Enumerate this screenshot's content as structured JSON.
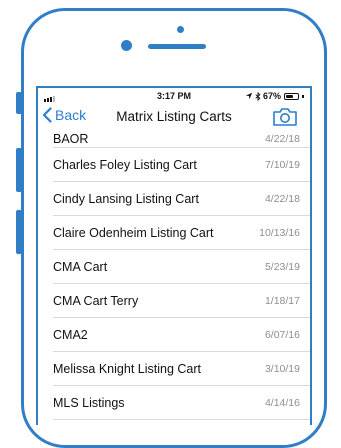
{
  "status_bar": {
    "time": "3:17 PM",
    "location_icon": "location-arrow-icon",
    "bluetooth_icon": "bluetooth-icon",
    "battery_text": "67%",
    "battery_level": 0.67
  },
  "nav": {
    "back_label": "Back",
    "title": "Matrix Listing Carts",
    "camera_icon": "camera-icon"
  },
  "carts": [
    {
      "title": "BAOR",
      "date": "4/22/18"
    },
    {
      "title": "Charles Foley Listing Cart",
      "date": "7/10/19"
    },
    {
      "title": "Cindy Lansing Listing Cart",
      "date": "4/22/18"
    },
    {
      "title": "Claire Odenheim Listing Cart",
      "date": "10/13/16"
    },
    {
      "title": "CMA Cart",
      "date": "5/23/19"
    },
    {
      "title": "CMA Cart Terry",
      "date": "1/18/17"
    },
    {
      "title": "CMA2",
      "date": "6/07/16"
    },
    {
      "title": "Melissa Knight Listing Cart",
      "date": "3/10/19"
    },
    {
      "title": "MLS Listings",
      "date": "4/14/16"
    }
  ],
  "colors": {
    "frame": "#2f7ec6",
    "accent": "#2a7fd1",
    "secondary_text": "#8e8e93",
    "separator": "#d9d9dd"
  }
}
